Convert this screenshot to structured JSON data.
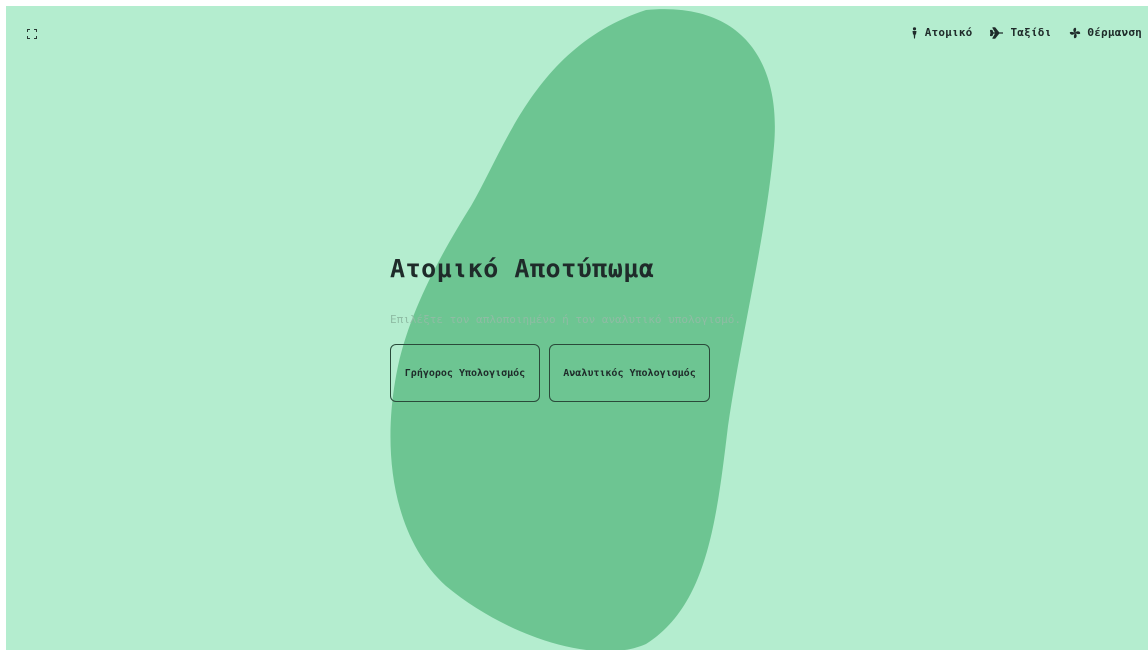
{
  "colors": {
    "background": "#b4edcf",
    "blob": "#6dc592",
    "text": "#1f2b2a",
    "subtitle": "#8fbca4",
    "button_border": "#2a4a3a"
  },
  "topbar": {
    "expand_icon": "fullscreen-expand-icon"
  },
  "nav": {
    "items": [
      {
        "label": "Ατομικό",
        "icon": "person-icon"
      },
      {
        "label": "Ταξίδι",
        "icon": "airplane-icon"
      },
      {
        "label": "Θέρμανση",
        "icon": "fan-icon"
      }
    ]
  },
  "hero": {
    "title": "Ατομικό Αποτύπωμα",
    "subtitle": "Επιλέξτε τον απλοποιημένο ή τον αναλυτικό υπολογισμό."
  },
  "buttons": {
    "quick": "Γρήγορος Υπολογισμός",
    "analytic": "Αναλυτικός Υπολογισμός"
  }
}
